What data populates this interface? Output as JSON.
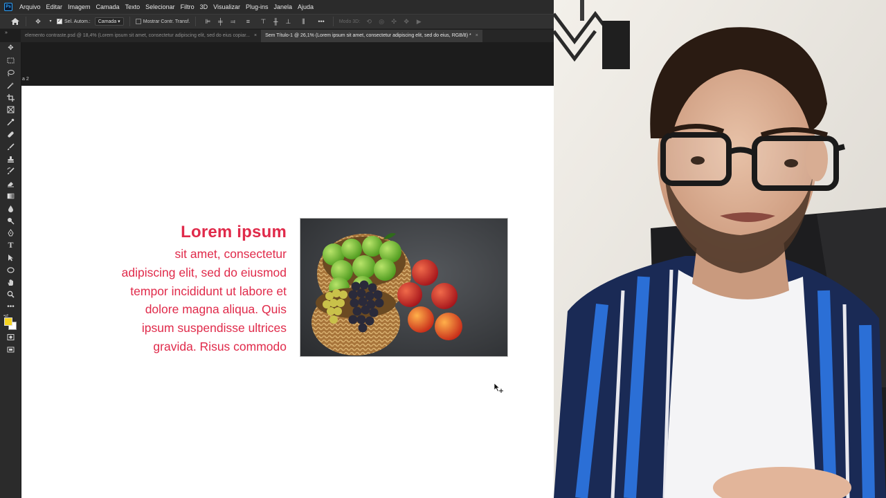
{
  "app": {
    "logo": "Ps"
  },
  "menu": [
    "Arquivo",
    "Editar",
    "Imagem",
    "Camada",
    "Texto",
    "Selecionar",
    "Filtro",
    "3D",
    "Visualizar",
    "Plug-ins",
    "Janela",
    "Ajuda"
  ],
  "options": {
    "auto_select_label": "Sel. Autom.:",
    "auto_select_value": "Camada",
    "show_transform_label": "Mostrar Contr. Transf.",
    "mode_3d_label": "Modo 3D:",
    "more": "•••"
  },
  "tabs": [
    {
      "label": "elemento contraste.psd @ 18,4% (Lorem ipsum  sit amet, consectetur adipiscing elit, sed do eius copiar...",
      "close": "×",
      "active": false
    },
    {
      "label": "Sem Título-1 @ 26,1% (Lorem ipsum  sit amet, consectetur adipiscing elit, sed do eius, RGB/8) *",
      "close": "×",
      "active": true
    }
  ],
  "panel_label": "a 2",
  "collapse": "»",
  "canvas": {
    "title": "Lorem ipsum",
    "body_lines": [
      "sit amet, consectetur",
      "adipiscing elit, sed do eiusmod",
      "tempor incididunt ut labore et",
      "dolore magna aliqua. Quis",
      "ipsum suspendisse ultrices",
      "gravida. Risus commodo"
    ],
    "accent_color": "#e02a4a"
  },
  "colors": {
    "foreground": "#f5d320",
    "background": "#ffffff"
  }
}
